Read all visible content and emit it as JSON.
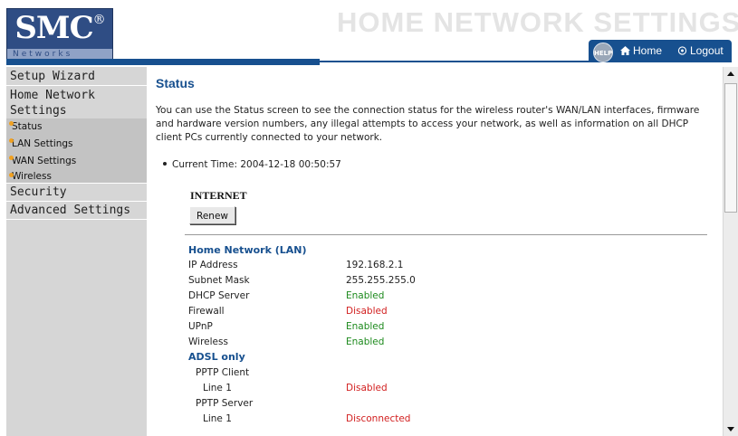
{
  "header": {
    "logo": {
      "brand": "SMC",
      "registered": "®",
      "sub": "Networks"
    },
    "banner_title": "HOME NETWORK SETTINGS",
    "help_label": "HELP",
    "home_label": "Home",
    "logout_label": "Logout"
  },
  "sidebar": {
    "setup_wizard": "Setup Wizard",
    "home_network_settings_1": "Home Network",
    "home_network_settings_2": "Settings",
    "sub_items": [
      "Status",
      "LAN Settings",
      "WAN Settings",
      "Wireless"
    ],
    "security": "Security",
    "advanced": "Advanced Settings"
  },
  "main": {
    "title": "Status",
    "intro": "You can use the Status screen to see the connection status for the wireless router's WAN/LAN interfaces, firmware and hardware version numbers, any illegal attempts to access your network, as well as information on all DHCP client PCs currently connected to your network.",
    "current_time_label": "Current Time: 2004-12-18 00:50:57",
    "internet_heading": "INTERNET",
    "renew_label": "Renew",
    "lan_heading": "Home Network (LAN)",
    "lan_rows": [
      {
        "label": "IP Address",
        "value": "192.168.2.1"
      },
      {
        "label": "Subnet Mask",
        "value": "255.255.255.0"
      },
      {
        "label": "DHCP Server",
        "value": "Enabled"
      },
      {
        "label": "Firewall",
        "value": "Disabled"
      },
      {
        "label": "UPnP",
        "value": "Enabled"
      },
      {
        "label": "Wireless",
        "value": "Enabled"
      }
    ],
    "adsl_heading": "ADSL only",
    "adsl_rows": [
      {
        "label": "PPTP Client",
        "value": ""
      },
      {
        "label": "Line 1",
        "value": "Disabled"
      },
      {
        "label": "PPTP Server",
        "value": ""
      },
      {
        "label": "Line 1",
        "value": "Disconnected"
      }
    ]
  },
  "colors": {
    "brand_blue": "#17508f",
    "enabled_green": "#1d8a1d",
    "disabled_red": "#d22020",
    "sidebar_bg": "#d6d6d6",
    "bullet_orange": "#f0a020"
  },
  "icons": {
    "help": "help-globe-icon",
    "home": "house-icon",
    "logout": "power-icon",
    "scroll_up": "arrow-up-icon",
    "scroll_down": "arrow-down-icon"
  }
}
